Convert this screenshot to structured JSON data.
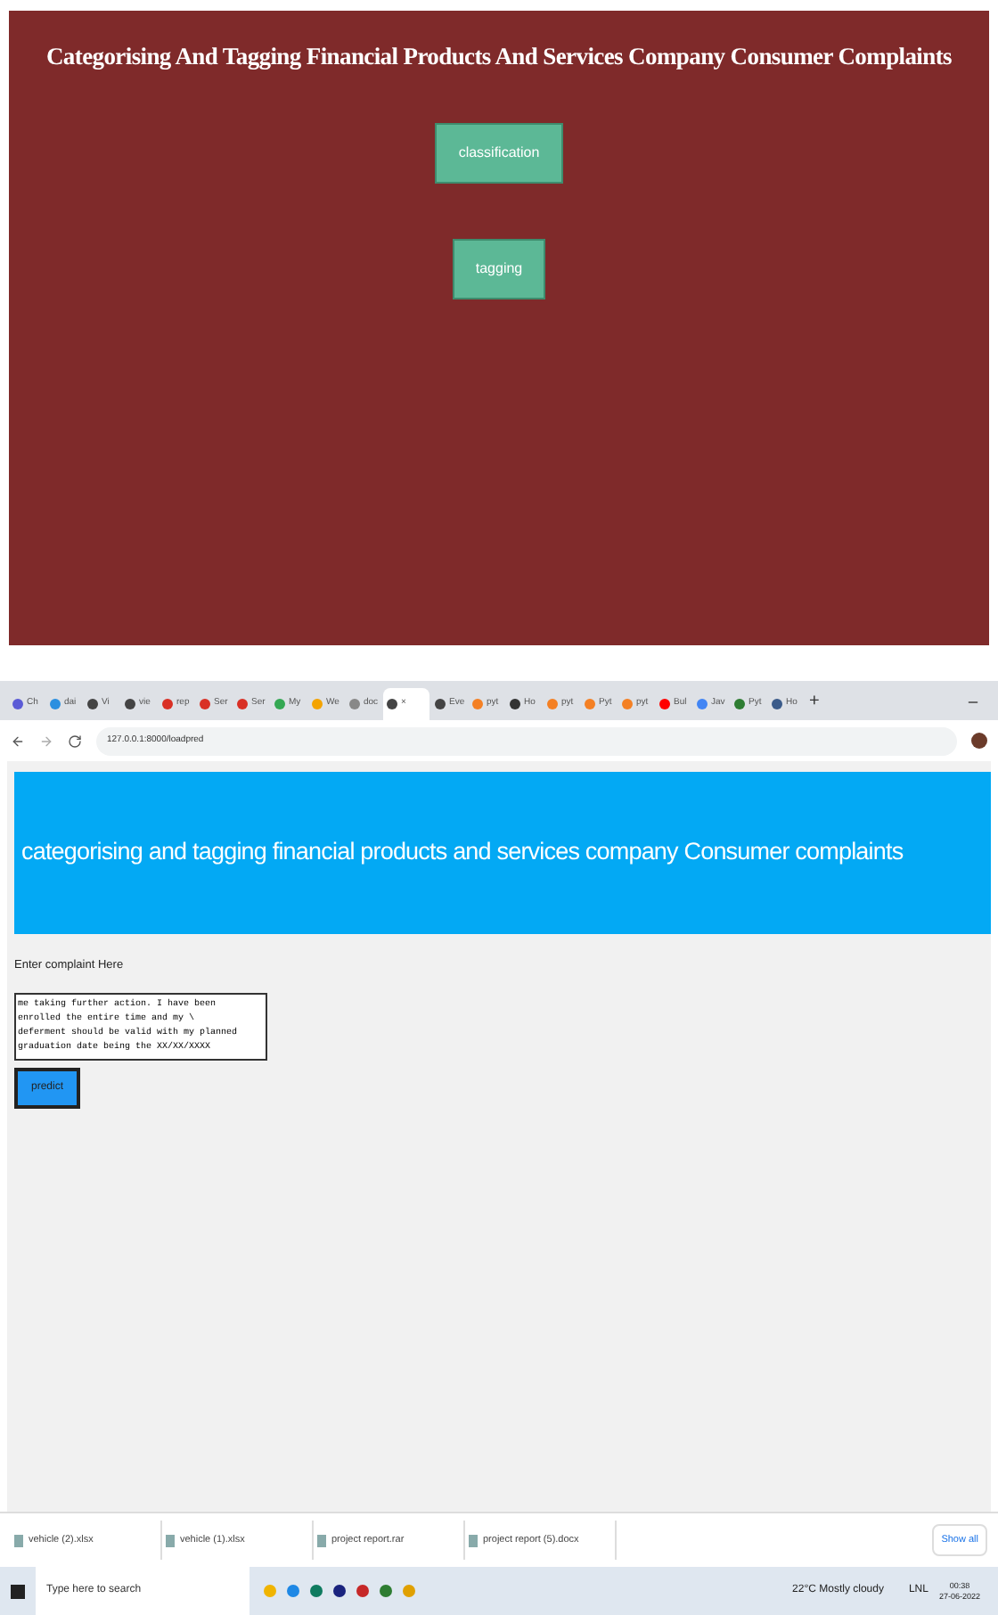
{
  "top_page": {
    "title": "Categorising And Tagging Financial Products And Services Company Consumer Complaints",
    "buttons": [
      "classification",
      "tagging"
    ]
  },
  "browser": {
    "tabs": [
      {
        "label": "Ch",
        "selected": false,
        "color": "#5b5bd6"
      },
      {
        "label": "dai",
        "selected": false,
        "color": "#2a8fe0"
      },
      {
        "label": "Vi",
        "selected": false,
        "color": "#444444"
      },
      {
        "label": "vie",
        "selected": false,
        "color": "#444444"
      },
      {
        "label": "rep",
        "selected": false,
        "color": "#d93025"
      },
      {
        "label": "Ser",
        "selected": false,
        "color": "#d93025"
      },
      {
        "label": "Ser",
        "selected": false,
        "color": "#d93025"
      },
      {
        "label": "My",
        "selected": false,
        "color": "#34a853"
      },
      {
        "label": "We",
        "selected": false,
        "color": "#f4a300"
      },
      {
        "label": "doc",
        "selected": false,
        "color": "#888888"
      },
      {
        "label": "×",
        "selected": true,
        "color": "#444444"
      },
      {
        "label": "Eve",
        "selected": false,
        "color": "#444444"
      },
      {
        "label": "pyt",
        "selected": false,
        "color": "#f48024"
      },
      {
        "label": "Ho",
        "selected": false,
        "color": "#333333"
      },
      {
        "label": "pyt",
        "selected": false,
        "color": "#f48024"
      },
      {
        "label": "Pyt",
        "selected": false,
        "color": "#f48024"
      },
      {
        "label": "pyt",
        "selected": false,
        "color": "#f48024"
      },
      {
        "label": "Bul",
        "selected": false,
        "color": "#ff0000"
      },
      {
        "label": "Jav",
        "selected": false,
        "color": "#4285f4"
      },
      {
        "label": "Pyt",
        "selected": false,
        "color": "#2e7d32"
      },
      {
        "label": "Ho",
        "selected": false,
        "color": "#3b5b8a"
      }
    ],
    "new_tab": "+",
    "url": "127.0.0.1:8000/loadpred"
  },
  "page": {
    "banner": "categorising and tagging financial products and services company Consumer complaints",
    "label": "Enter complaint Here",
    "complaint": "me taking further action. I have been enrolled the entire time and my \\\ndeferment should be valid with my planned graduation date being the XX/XX/XXXX",
    "button": "predict"
  },
  "downloads": {
    "items": [
      "vehicle (2).xlsx",
      "vehicle (1).xlsx",
      "project report.rar",
      "project report (5).docx"
    ],
    "show_all": "Show all"
  },
  "taskbar": {
    "search_placeholder": "Type here to search",
    "weather": "22°C  Mostly cloudy",
    "lang": "LNL",
    "time": "00:38",
    "date": "27-06-2022"
  }
}
